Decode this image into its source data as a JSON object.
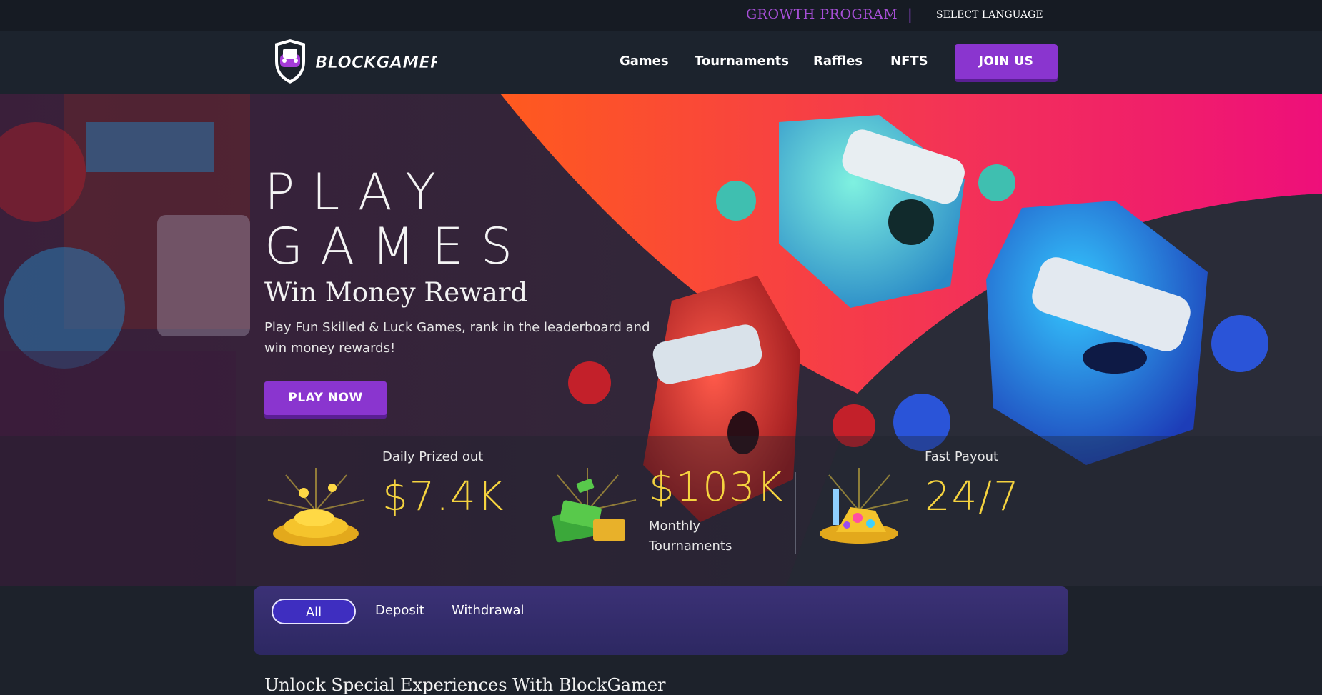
{
  "topbar": {
    "growth_program": "GROWTH PROGRAM",
    "separator": "|",
    "select_language": "SELECT LANGUAGE"
  },
  "nav": {
    "logo_text": "BLOCKGAMER",
    "items": [
      {
        "label": "Games"
      },
      {
        "label": "Tournaments"
      },
      {
        "label": "Raffles"
      },
      {
        "label": "NFTS"
      }
    ],
    "join_label": "JOIN US"
  },
  "hero": {
    "title_line1": "PLAY",
    "title_line2": "GAMES",
    "subtitle": "Win Money Reward",
    "description": "Play Fun Skilled & Luck Games, rank in the leaderboard and win money rewards!",
    "cta_label": "PLAY NOW",
    "stats": [
      {
        "value": "$7.4K",
        "label": "Daily Prized out",
        "icon": "gold-coins-icon"
      },
      {
        "value": "$103K",
        "label_line1": "Monthly",
        "label_line2": "Tournaments",
        "icon": "cash-pile-icon"
      },
      {
        "value": "24/7",
        "label": "Fast Payout",
        "icon": "treasure-icon"
      }
    ]
  },
  "filters": {
    "tabs": [
      {
        "label": "All",
        "active": true
      },
      {
        "label": "Deposit"
      },
      {
        "label": "Withdrawal"
      }
    ]
  },
  "section": {
    "title": "Unlock Special Experiences With BlockGamer"
  },
  "colors": {
    "accent_purple": "#8a35cf",
    "gold": "#f5d33f",
    "hero_pink": "#f01478",
    "hero_orange": "#ff5a1e"
  }
}
